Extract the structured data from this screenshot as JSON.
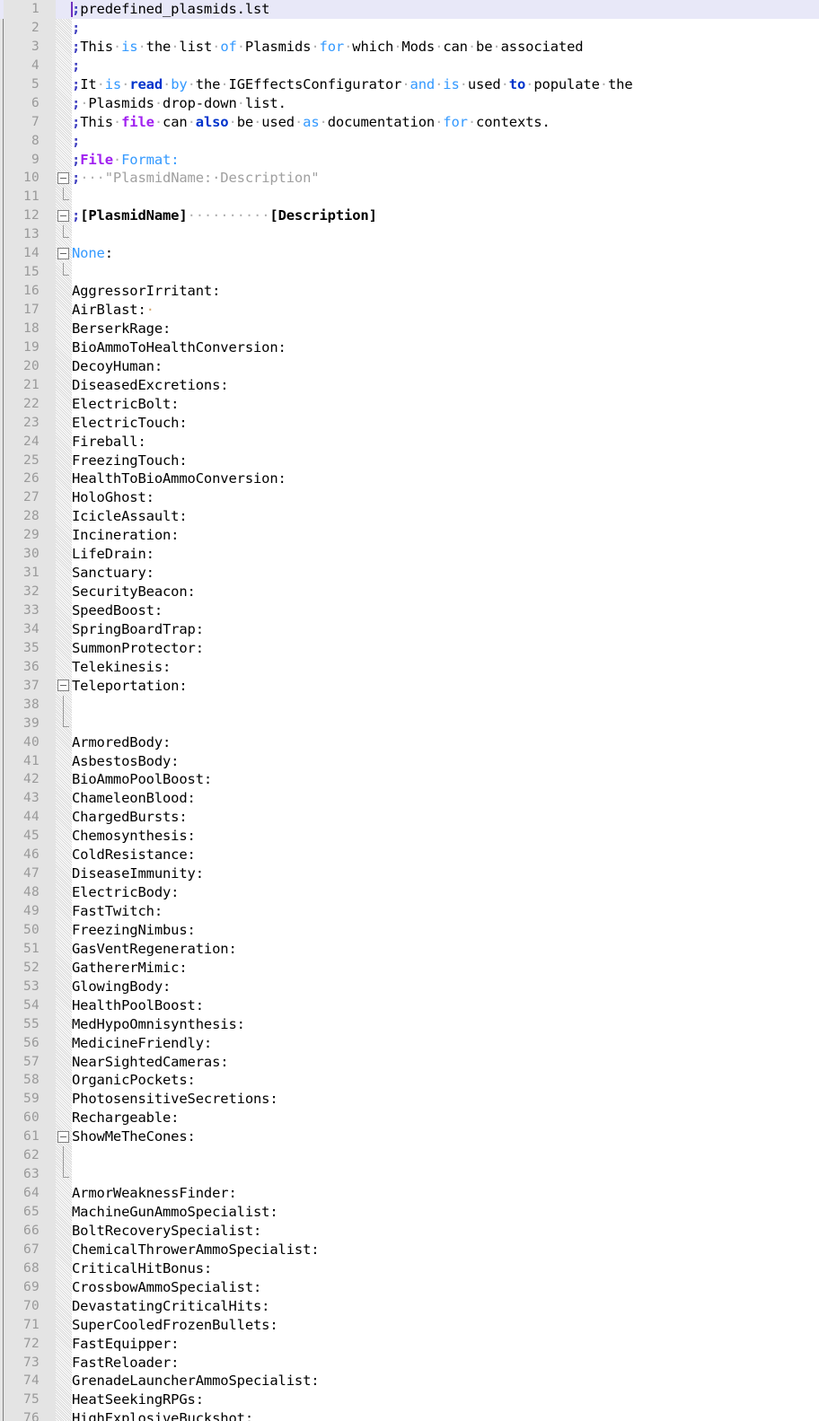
{
  "app": {
    "type": "code-editor",
    "file_name": "predefined_plasmids.lst",
    "language": "properties",
    "current_line": 1,
    "total_visible_lines": 76
  },
  "colors": {
    "gutter_bg": "#e4e4e4",
    "line_number": "#9a9a9a",
    "current_line_bg": "#e8e8f8",
    "caret": "#7030c0",
    "editor_bg": "#ffffff",
    "default_text": "#000000",
    "keyword_blue": "#3399ff",
    "keyword_blue_bold": "#0033cc",
    "keyword_purple": "#a020f0",
    "comment_gray": "#a0a0a0",
    "semicolon": "#4040c0",
    "whitespace_dot": "#b0b0b0",
    "fold_marker": "#808080"
  },
  "lines": [
    {
      "n": 1,
      "fold": "none",
      "current": true,
      "caret": true,
      "tokens": [
        {
          "t": ";",
          "c": "tk-semi"
        },
        {
          "t": "predefined_plasmids.lst",
          "c": "tk-comment"
        }
      ]
    },
    {
      "n": 2,
      "fold": "none",
      "tokens": [
        {
          "t": ";",
          "c": "tk-semi"
        }
      ]
    },
    {
      "n": 3,
      "fold": "none",
      "tokens": [
        {
          "t": ";",
          "c": "tk-semi"
        },
        {
          "t": "This",
          "c": "tk-comment"
        },
        {
          "t": "·",
          "c": "ws"
        },
        {
          "t": "is",
          "c": "tk-blue"
        },
        {
          "t": "·",
          "c": "ws"
        },
        {
          "t": "the",
          "c": "tk-comment"
        },
        {
          "t": "·",
          "c": "ws"
        },
        {
          "t": "list",
          "c": "tk-comment"
        },
        {
          "t": "·",
          "c": "ws"
        },
        {
          "t": "of",
          "c": "tk-blue"
        },
        {
          "t": "·",
          "c": "ws"
        },
        {
          "t": "Plasmids",
          "c": "tk-comment"
        },
        {
          "t": "·",
          "c": "ws"
        },
        {
          "t": "for",
          "c": "tk-blue"
        },
        {
          "t": "·",
          "c": "ws"
        },
        {
          "t": "which",
          "c": "tk-comment"
        },
        {
          "t": "·",
          "c": "ws"
        },
        {
          "t": "Mods",
          "c": "tk-comment"
        },
        {
          "t": "·",
          "c": "ws"
        },
        {
          "t": "can",
          "c": "tk-comment"
        },
        {
          "t": "·",
          "c": "ws"
        },
        {
          "t": "be",
          "c": "tk-comment"
        },
        {
          "t": "·",
          "c": "ws"
        },
        {
          "t": "associated",
          "c": "tk-comment"
        }
      ]
    },
    {
      "n": 4,
      "fold": "none",
      "tokens": [
        {
          "t": ";",
          "c": "tk-semi"
        }
      ]
    },
    {
      "n": 5,
      "fold": "none",
      "tokens": [
        {
          "t": ";",
          "c": "tk-semi"
        },
        {
          "t": "It",
          "c": "tk-comment"
        },
        {
          "t": "·",
          "c": "ws"
        },
        {
          "t": "is",
          "c": "tk-blue"
        },
        {
          "t": "·",
          "c": "ws"
        },
        {
          "t": "read",
          "c": "tk-blueb"
        },
        {
          "t": "·",
          "c": "ws"
        },
        {
          "t": "by",
          "c": "tk-blue"
        },
        {
          "t": "·",
          "c": "ws"
        },
        {
          "t": "the",
          "c": "tk-comment"
        },
        {
          "t": "·",
          "c": "ws"
        },
        {
          "t": "IGEffectsConfigurator",
          "c": "tk-comment"
        },
        {
          "t": "·",
          "c": "ws"
        },
        {
          "t": "and",
          "c": "tk-blue"
        },
        {
          "t": "·",
          "c": "ws"
        },
        {
          "t": "is",
          "c": "tk-blue"
        },
        {
          "t": "·",
          "c": "ws"
        },
        {
          "t": "used",
          "c": "tk-comment"
        },
        {
          "t": "·",
          "c": "ws"
        },
        {
          "t": "to",
          "c": "tk-blueb"
        },
        {
          "t": "·",
          "c": "ws"
        },
        {
          "t": "populate",
          "c": "tk-comment"
        },
        {
          "t": "·",
          "c": "ws"
        },
        {
          "t": "the",
          "c": "tk-comment"
        }
      ]
    },
    {
      "n": 6,
      "fold": "none",
      "tokens": [
        {
          "t": ";",
          "c": "tk-semi"
        },
        {
          "t": "·",
          "c": "ws"
        },
        {
          "t": "Plasmids",
          "c": "tk-comment"
        },
        {
          "t": "·",
          "c": "ws"
        },
        {
          "t": "drop-down",
          "c": "tk-comment"
        },
        {
          "t": "·",
          "c": "ws"
        },
        {
          "t": "list.",
          "c": "tk-comment"
        }
      ]
    },
    {
      "n": 7,
      "fold": "none",
      "tokens": [
        {
          "t": ";",
          "c": "tk-semi"
        },
        {
          "t": "This",
          "c": "tk-comment"
        },
        {
          "t": "·",
          "c": "ws"
        },
        {
          "t": "file",
          "c": "tk-purple"
        },
        {
          "t": "·",
          "c": "ws"
        },
        {
          "t": "can",
          "c": "tk-comment"
        },
        {
          "t": "·",
          "c": "ws"
        },
        {
          "t": "also",
          "c": "tk-blueb"
        },
        {
          "t": "·",
          "c": "ws"
        },
        {
          "t": "be",
          "c": "tk-comment"
        },
        {
          "t": "·",
          "c": "ws"
        },
        {
          "t": "used",
          "c": "tk-comment"
        },
        {
          "t": "·",
          "c": "ws"
        },
        {
          "t": "as",
          "c": "tk-blue"
        },
        {
          "t": "·",
          "c": "ws"
        },
        {
          "t": "documentation",
          "c": "tk-comment"
        },
        {
          "t": "·",
          "c": "ws"
        },
        {
          "t": "for",
          "c": "tk-blue"
        },
        {
          "t": "·",
          "c": "ws"
        },
        {
          "t": "contexts.",
          "c": "tk-comment"
        }
      ]
    },
    {
      "n": 8,
      "fold": "none",
      "tokens": [
        {
          "t": ";",
          "c": "tk-semi"
        }
      ]
    },
    {
      "n": 9,
      "fold": "none",
      "tokens": [
        {
          "t": ";",
          "c": "tk-semi"
        },
        {
          "t": "File",
          "c": "tk-purple"
        },
        {
          "t": "·",
          "c": "ws"
        },
        {
          "t": "Format:",
          "c": "tk-blue"
        }
      ]
    },
    {
      "n": 10,
      "fold": "box",
      "tokens": [
        {
          "t": ";",
          "c": "tk-semi"
        },
        {
          "t": "···",
          "c": "ws"
        },
        {
          "t": "\"PlasmidName:·Description\"",
          "c": "tk-gray"
        }
      ]
    },
    {
      "n": 11,
      "fold": "tail",
      "tokens": []
    },
    {
      "n": 12,
      "fold": "box",
      "tokens": [
        {
          "t": ";",
          "c": "tk-semi"
        },
        {
          "t": "[PlasmidName]",
          "c": "tk-bold"
        },
        {
          "t": "··········",
          "c": "ws"
        },
        {
          "t": "[Description]",
          "c": "tk-bold"
        }
      ]
    },
    {
      "n": 13,
      "fold": "tail",
      "tokens": []
    },
    {
      "n": 14,
      "fold": "box",
      "tokens": [
        {
          "t": "None",
          "c": "tk-blue"
        },
        {
          "t": ":",
          "c": "tk-comment"
        }
      ]
    },
    {
      "n": 15,
      "fold": "tail",
      "tokens": []
    },
    {
      "n": 16,
      "fold": "none",
      "tokens": [
        {
          "t": "AggressorIrritant:",
          "c": "tk-comment"
        }
      ]
    },
    {
      "n": 17,
      "fold": "none",
      "tokens": [
        {
          "t": "AirBlast:",
          "c": "tk-comment"
        },
        {
          "t": "·",
          "c": "ws-tab"
        }
      ]
    },
    {
      "n": 18,
      "fold": "none",
      "tokens": [
        {
          "t": "BerserkRage:",
          "c": "tk-comment"
        }
      ]
    },
    {
      "n": 19,
      "fold": "none",
      "tokens": [
        {
          "t": "BioAmmoToHealthConversion:",
          "c": "tk-comment"
        }
      ]
    },
    {
      "n": 20,
      "fold": "none",
      "tokens": [
        {
          "t": "DecoyHuman:",
          "c": "tk-comment"
        }
      ]
    },
    {
      "n": 21,
      "fold": "none",
      "tokens": [
        {
          "t": "DiseasedExcretions:",
          "c": "tk-comment"
        }
      ]
    },
    {
      "n": 22,
      "fold": "none",
      "tokens": [
        {
          "t": "ElectricBolt:",
          "c": "tk-comment"
        }
      ]
    },
    {
      "n": 23,
      "fold": "none",
      "tokens": [
        {
          "t": "ElectricTouch:",
          "c": "tk-comment"
        }
      ]
    },
    {
      "n": 24,
      "fold": "none",
      "tokens": [
        {
          "t": "Fireball:",
          "c": "tk-comment"
        }
      ]
    },
    {
      "n": 25,
      "fold": "none",
      "tokens": [
        {
          "t": "FreezingTouch:",
          "c": "tk-comment"
        }
      ]
    },
    {
      "n": 26,
      "fold": "none",
      "tokens": [
        {
          "t": "HealthToBioAmmoConversion:",
          "c": "tk-comment"
        }
      ]
    },
    {
      "n": 27,
      "fold": "none",
      "tokens": [
        {
          "t": "HoloGhost:",
          "c": "tk-comment"
        }
      ]
    },
    {
      "n": 28,
      "fold": "none",
      "tokens": [
        {
          "t": "IcicleAssault:",
          "c": "tk-comment"
        }
      ]
    },
    {
      "n": 29,
      "fold": "none",
      "tokens": [
        {
          "t": "Incineration:",
          "c": "tk-comment"
        }
      ]
    },
    {
      "n": 30,
      "fold": "none",
      "tokens": [
        {
          "t": "LifeDrain:",
          "c": "tk-comment"
        }
      ]
    },
    {
      "n": 31,
      "fold": "none",
      "tokens": [
        {
          "t": "Sanctuary:",
          "c": "tk-comment"
        }
      ]
    },
    {
      "n": 32,
      "fold": "none",
      "tokens": [
        {
          "t": "SecurityBeacon:",
          "c": "tk-comment"
        }
      ]
    },
    {
      "n": 33,
      "fold": "none",
      "tokens": [
        {
          "t": "SpeedBoost:",
          "c": "tk-comment"
        }
      ]
    },
    {
      "n": 34,
      "fold": "none",
      "tokens": [
        {
          "t": "SpringBoardTrap:",
          "c": "tk-comment"
        }
      ]
    },
    {
      "n": 35,
      "fold": "none",
      "tokens": [
        {
          "t": "SummonProtector:",
          "c": "tk-comment"
        }
      ]
    },
    {
      "n": 36,
      "fold": "none",
      "tokens": [
        {
          "t": "Telekinesis:",
          "c": "tk-comment"
        }
      ]
    },
    {
      "n": 37,
      "fold": "box",
      "tokens": [
        {
          "t": "Teleportation:",
          "c": "tk-comment"
        }
      ]
    },
    {
      "n": 38,
      "fold": "line",
      "tokens": []
    },
    {
      "n": 39,
      "fold": "tail",
      "tokens": []
    },
    {
      "n": 40,
      "fold": "none",
      "tokens": [
        {
          "t": "ArmoredBody:",
          "c": "tk-comment"
        }
      ]
    },
    {
      "n": 41,
      "fold": "none",
      "tokens": [
        {
          "t": "AsbestosBody:",
          "c": "tk-comment"
        }
      ]
    },
    {
      "n": 42,
      "fold": "none",
      "tokens": [
        {
          "t": "BioAmmoPoolBoost:",
          "c": "tk-comment"
        }
      ]
    },
    {
      "n": 43,
      "fold": "none",
      "tokens": [
        {
          "t": "ChameleonBlood:",
          "c": "tk-comment"
        }
      ]
    },
    {
      "n": 44,
      "fold": "none",
      "tokens": [
        {
          "t": "ChargedBursts:",
          "c": "tk-comment"
        }
      ]
    },
    {
      "n": 45,
      "fold": "none",
      "tokens": [
        {
          "t": "Chemosynthesis:",
          "c": "tk-comment"
        }
      ]
    },
    {
      "n": 46,
      "fold": "none",
      "tokens": [
        {
          "t": "ColdResistance:",
          "c": "tk-comment"
        }
      ]
    },
    {
      "n": 47,
      "fold": "none",
      "tokens": [
        {
          "t": "DiseaseImmunity:",
          "c": "tk-comment"
        }
      ]
    },
    {
      "n": 48,
      "fold": "none",
      "tokens": [
        {
          "t": "ElectricBody:",
          "c": "tk-comment"
        }
      ]
    },
    {
      "n": 49,
      "fold": "none",
      "tokens": [
        {
          "t": "FastTwitch:",
          "c": "tk-comment"
        }
      ]
    },
    {
      "n": 50,
      "fold": "none",
      "tokens": [
        {
          "t": "FreezingNimbus:",
          "c": "tk-comment"
        }
      ]
    },
    {
      "n": 51,
      "fold": "none",
      "tokens": [
        {
          "t": "GasVentRegeneration:",
          "c": "tk-comment"
        }
      ]
    },
    {
      "n": 52,
      "fold": "none",
      "tokens": [
        {
          "t": "GathererMimic:",
          "c": "tk-comment"
        }
      ]
    },
    {
      "n": 53,
      "fold": "none",
      "tokens": [
        {
          "t": "GlowingBody:",
          "c": "tk-comment"
        }
      ]
    },
    {
      "n": 54,
      "fold": "none",
      "tokens": [
        {
          "t": "HealthPoolBoost:",
          "c": "tk-comment"
        }
      ]
    },
    {
      "n": 55,
      "fold": "none",
      "tokens": [
        {
          "t": "MedHypoOmnisynthesis:",
          "c": "tk-comment"
        }
      ]
    },
    {
      "n": 56,
      "fold": "none",
      "tokens": [
        {
          "t": "MedicineFriendly:",
          "c": "tk-comment"
        }
      ]
    },
    {
      "n": 57,
      "fold": "none",
      "tokens": [
        {
          "t": "NearSightedCameras:",
          "c": "tk-comment"
        }
      ]
    },
    {
      "n": 58,
      "fold": "none",
      "tokens": [
        {
          "t": "OrganicPockets:",
          "c": "tk-comment"
        }
      ]
    },
    {
      "n": 59,
      "fold": "none",
      "tokens": [
        {
          "t": "PhotosensitiveSecretions:",
          "c": "tk-comment"
        }
      ]
    },
    {
      "n": 60,
      "fold": "none",
      "tokens": [
        {
          "t": "Rechargeable:",
          "c": "tk-comment"
        }
      ]
    },
    {
      "n": 61,
      "fold": "box",
      "tokens": [
        {
          "t": "ShowMeTheCones:",
          "c": "tk-comment"
        }
      ]
    },
    {
      "n": 62,
      "fold": "line",
      "tokens": []
    },
    {
      "n": 63,
      "fold": "tail",
      "tokens": []
    },
    {
      "n": 64,
      "fold": "none",
      "tokens": [
        {
          "t": "ArmorWeaknessFinder:",
          "c": "tk-comment"
        }
      ]
    },
    {
      "n": 65,
      "fold": "none",
      "tokens": [
        {
          "t": "MachineGunAmmoSpecialist:",
          "c": "tk-comment"
        }
      ]
    },
    {
      "n": 66,
      "fold": "none",
      "tokens": [
        {
          "t": "BoltRecoverySpecialist:",
          "c": "tk-comment"
        }
      ]
    },
    {
      "n": 67,
      "fold": "none",
      "tokens": [
        {
          "t": "ChemicalThrowerAmmoSpecialist:",
          "c": "tk-comment"
        }
      ]
    },
    {
      "n": 68,
      "fold": "none",
      "tokens": [
        {
          "t": "CriticalHitBonus:",
          "c": "tk-comment"
        }
      ]
    },
    {
      "n": 69,
      "fold": "none",
      "tokens": [
        {
          "t": "CrossbowAmmoSpecialist:",
          "c": "tk-comment"
        }
      ]
    },
    {
      "n": 70,
      "fold": "none",
      "tokens": [
        {
          "t": "DevastatingCriticalHits:",
          "c": "tk-comment"
        }
      ]
    },
    {
      "n": 71,
      "fold": "none",
      "tokens": [
        {
          "t": "SuperCooledFrozenBullets:",
          "c": "tk-comment"
        }
      ]
    },
    {
      "n": 72,
      "fold": "none",
      "tokens": [
        {
          "t": "FastEquipper:",
          "c": "tk-comment"
        }
      ]
    },
    {
      "n": 73,
      "fold": "none",
      "tokens": [
        {
          "t": "FastReloader:",
          "c": "tk-comment"
        }
      ]
    },
    {
      "n": 74,
      "fold": "none",
      "tokens": [
        {
          "t": "GrenadeLauncherAmmoSpecialist:",
          "c": "tk-comment"
        }
      ]
    },
    {
      "n": 75,
      "fold": "none",
      "tokens": [
        {
          "t": "HeatSeekingRPGs:",
          "c": "tk-comment"
        }
      ]
    },
    {
      "n": 76,
      "fold": "none",
      "tokens": [
        {
          "t": "HighExplosiveBuckshot:",
          "c": "tk-comment"
        }
      ]
    }
  ]
}
